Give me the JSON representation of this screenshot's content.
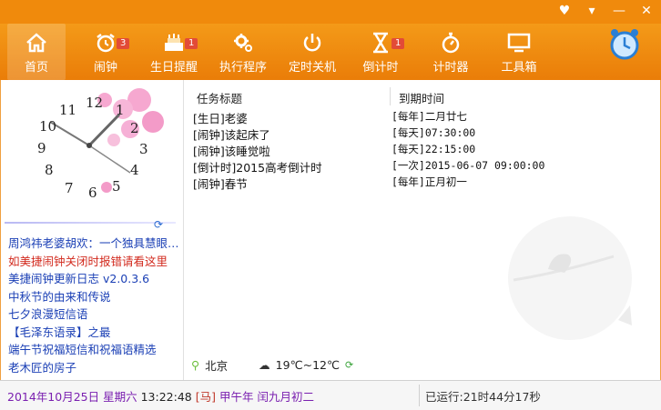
{
  "toolbar": {
    "items": [
      {
        "label": "首页",
        "icon": "home-icon"
      },
      {
        "label": "闹钟",
        "icon": "alarm-icon",
        "badge": "3"
      },
      {
        "label": "生日提醒",
        "icon": "cake-icon",
        "badge": "1"
      },
      {
        "label": "执行程序",
        "icon": "gear-icon"
      },
      {
        "label": "定时关机",
        "icon": "power-icon"
      },
      {
        "label": "倒计时",
        "icon": "hourglass-icon",
        "badge": "1"
      },
      {
        "label": "计时器",
        "icon": "stopwatch-icon"
      },
      {
        "label": "工具箱",
        "icon": "monitor-icon"
      }
    ]
  },
  "clock": {
    "numbers": [
      "12",
      "1",
      "2",
      "3",
      "4",
      "5",
      "6",
      "7",
      "8",
      "9",
      "10",
      "11"
    ]
  },
  "news": [
    "周鸿祎老婆胡欢：一个独具慧眼的女人",
    "如美捷闹钟关闭时报错请看这里",
    "美捷闹钟更新日志  v2.0.3.6",
    "中秋节的由来和传说",
    "七夕浪漫短信语",
    "【毛泽东语录】之最",
    "端午节祝福短信和祝福语精选",
    "老木匠的房子"
  ],
  "table": {
    "headers": [
      "任务标题",
      "到期时间"
    ],
    "rows": [
      [
        "[生日]老婆",
        "[每年]二月廿七"
      ],
      [
        "[闹钟]该起床了",
        "[每天]07:30:00"
      ],
      [
        "[闹钟]该睡觉啦",
        "[每天]22:15:00"
      ],
      [
        "[倒计时]2015高考倒计时",
        "[一次]2015-06-07 09:00:00"
      ],
      [
        "[闹钟]春节",
        "[每年]正月初一"
      ]
    ]
  },
  "weather": {
    "city": "北京",
    "temp": "19℃~12℃"
  },
  "status": {
    "date": "2014年10月25日",
    "weekday": "星期六",
    "time": "13:22:48",
    "zodiac": "[马]",
    "lunar_year": "甲午年",
    "lunar_date": "闰九月初二",
    "running": "已运行:21时44分17秒"
  },
  "colors": {
    "accent": "#f08a0c",
    "link_blue": "#1a3fb5",
    "link_red": "#d22a1e",
    "date_purple": "#7a1fb0"
  }
}
